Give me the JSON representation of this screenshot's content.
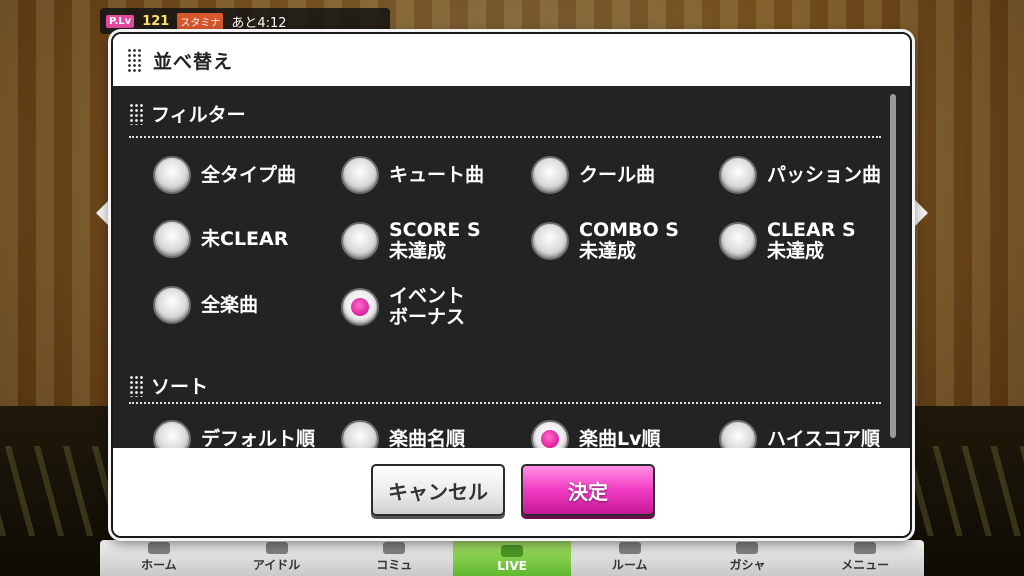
{
  "status": {
    "plv_label": "P.Lv",
    "plv_value": "121",
    "stamina_label": "スタミナ",
    "stamina_time": "あと4:12"
  },
  "dialog": {
    "title": "並べ替え",
    "filter_section": {
      "title": "フィルター",
      "options": [
        {
          "label": "全タイプ曲",
          "selected": false
        },
        {
          "label": "キュート曲",
          "selected": false
        },
        {
          "label": "クール曲",
          "selected": false
        },
        {
          "label": "パッション曲",
          "selected": false
        },
        {
          "label": "未CLEAR",
          "selected": false
        },
        {
          "label": "SCORE S\n未達成",
          "selected": false
        },
        {
          "label": "COMBO S\n未達成",
          "selected": false
        },
        {
          "label": "CLEAR S\n未達成",
          "selected": false
        },
        {
          "label": "全楽曲",
          "selected": false
        },
        {
          "label": "イベント\nボーナス",
          "selected": true
        }
      ]
    },
    "sort_section": {
      "title": "ソート",
      "options": [
        {
          "label": "デフォルト順",
          "selected": false
        },
        {
          "label": "楽曲名順",
          "selected": false
        },
        {
          "label": "楽曲Lv順",
          "selected": true
        },
        {
          "label": "ハイスコア順",
          "selected": false
        }
      ]
    },
    "cancel_label": "キャンセル",
    "confirm_label": "決定"
  },
  "bottom_nav": {
    "items": [
      {
        "label": "ホーム",
        "active": false
      },
      {
        "label": "アイドル",
        "active": false
      },
      {
        "label": "コミュ",
        "active": false
      },
      {
        "label": "LIVE",
        "active": true
      },
      {
        "label": "ルーム",
        "active": false
      },
      {
        "label": "ガシャ",
        "active": false
      },
      {
        "label": "メニュー",
        "active": false
      }
    ]
  },
  "colors": {
    "accent_pink": "#e01f9b",
    "live_green": "#5fb82e"
  }
}
